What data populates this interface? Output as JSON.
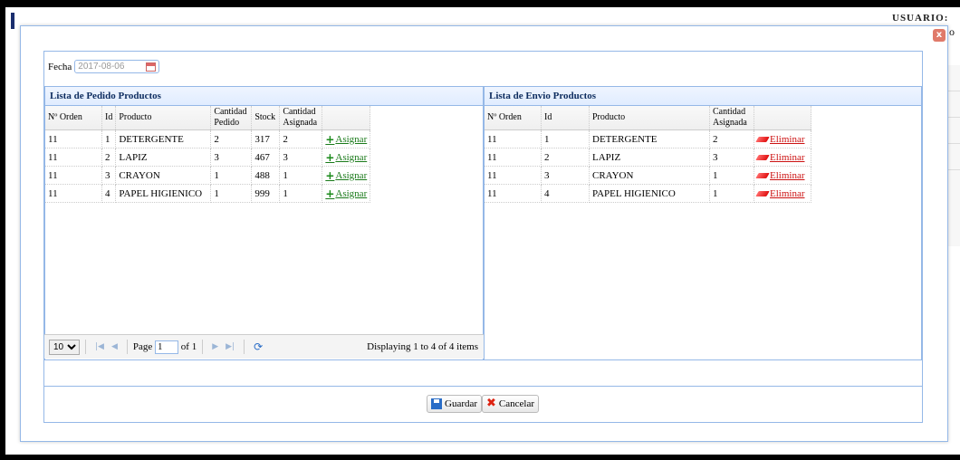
{
  "background": {
    "header_text": "USUARIO: J...",
    "side_text": "o"
  },
  "dialog": {
    "close_label": "x",
    "fecha": {
      "label": "Fecha",
      "value": "2017-08-06"
    },
    "left_grid": {
      "title": "Lista de Pedido Productos",
      "columns": [
        "Nº Orden",
        "Id",
        "Producto",
        "Cantidad Pedido",
        "Stock",
        "Cantidad Asignada",
        ""
      ],
      "rows": [
        {
          "orden": "11",
          "id": "1",
          "producto": "DETERGENTE",
          "pedido": "2",
          "stock": "317",
          "asignada": "2",
          "action": "Asignar"
        },
        {
          "orden": "11",
          "id": "2",
          "producto": "LAPIZ",
          "pedido": "3",
          "stock": "467",
          "asignada": "3",
          "action": "Asignar"
        },
        {
          "orden": "11",
          "id": "3",
          "producto": "CRAYON",
          "pedido": "1",
          "stock": "488",
          "asignada": "1",
          "action": "Asignar"
        },
        {
          "orden": "11",
          "id": "4",
          "producto": "PAPEL HIGIENICO",
          "pedido": "1",
          "stock": "999",
          "asignada": "1",
          "action": "Asignar"
        }
      ]
    },
    "right_grid": {
      "title": "Lista de Envio Productos",
      "columns": [
        "Nº Orden",
        "Id",
        "Producto",
        "Cantidad Asignada",
        ""
      ],
      "rows": [
        {
          "orden": "11",
          "id": "1",
          "producto": "DETERGENTE",
          "asignada": "2",
          "action": "Eliminar"
        },
        {
          "orden": "11",
          "id": "2",
          "producto": "LAPIZ",
          "asignada": "3",
          "action": "Eliminar"
        },
        {
          "orden": "11",
          "id": "3",
          "producto": "CRAYON",
          "asignada": "1",
          "action": "Eliminar"
        },
        {
          "orden": "11",
          "id": "4",
          "producto": "PAPEL HIGIENICO",
          "asignada": "1",
          "action": "Eliminar"
        }
      ]
    },
    "pager": {
      "page_size": "10",
      "page_label": "Page",
      "page_value": "1",
      "of_label": "of 1",
      "display_info": "Displaying 1 to 4 of 4 items"
    },
    "buttons": {
      "save": "Guardar",
      "cancel": "Cancelar"
    }
  },
  "colors": {
    "border": "#95b8e7",
    "title_text": "#0e2d5f",
    "add_link": "#1a7a1a",
    "delete_link": "#cc1111"
  }
}
